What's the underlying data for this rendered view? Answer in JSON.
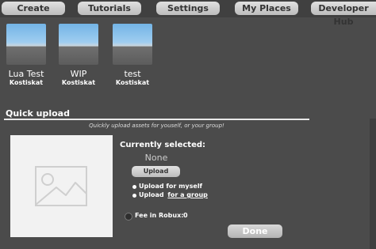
{
  "nav": {
    "create": "Create",
    "tutorials": "Tutorials",
    "settings": "Settings",
    "my_places": "My Places",
    "developer_hub": "Developer Hub"
  },
  "places": [
    {
      "name": "Lua Test",
      "owner": "Kostiskat"
    },
    {
      "name": "WIP",
      "owner": "Kostiskat"
    },
    {
      "name": "test",
      "owner": "Kostiskat"
    }
  ],
  "quick_upload": {
    "title": "Quick upload",
    "subtitle": "Quickly upload assets for youself, or your group!",
    "currently_selected_label": "Currently selected:",
    "currently_selected_value": "None",
    "upload_button": "Upload",
    "option_myself": "Upload for myself",
    "option_group_prefix": "Upload",
    "option_group_link": "for a group",
    "fee_label": "Fee in Robux:",
    "fee_value": "0",
    "done_button": "Done"
  },
  "colors": {
    "background": "#4b4b4b",
    "topbar": "#404040",
    "button": "#cfcfcf"
  },
  "icons": {
    "preview": "image-placeholder-icon",
    "fee": "robux-icon"
  }
}
